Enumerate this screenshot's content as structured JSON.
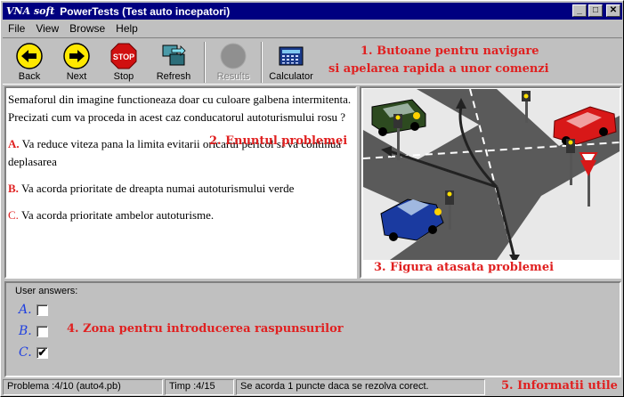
{
  "window": {
    "app_badge": "VNA soft",
    "title": "PowerTests (Test auto incepatori)",
    "buttons": {
      "minimize": "_",
      "maximize": "□",
      "close": "✕"
    }
  },
  "menu": {
    "items": [
      {
        "label": "File"
      },
      {
        "label": "View"
      },
      {
        "label": "Browse"
      },
      {
        "label": "Help"
      }
    ]
  },
  "toolbar": {
    "back": {
      "label": "Back",
      "icon": "arrow-left-icon"
    },
    "next": {
      "label": "Next",
      "icon": "arrow-right-icon"
    },
    "stop": {
      "label": "Stop",
      "icon": "stop-sign-icon",
      "sign_text": "STOP"
    },
    "refresh": {
      "label": "Refresh",
      "icon": "refresh-icon"
    },
    "results": {
      "label": "Results",
      "icon": "results-icon",
      "enabled": false
    },
    "calculator": {
      "label": "Calculator",
      "icon": "calculator-icon"
    }
  },
  "annotations": {
    "nav_line1": "1. Butoane pentru navigare",
    "nav_line2": "si apelarea rapida a unor comenzi",
    "problem": "2. Enuntul problemei",
    "figure": "3. Figura atasata problemei",
    "answers_zone": "4. Zona pentru introducerea raspunsurilor",
    "info": "5. Informatii utile"
  },
  "question": {
    "text": "Semaforul din imagine functioneaza doar cu culoare galbena intermitenta. Precizati cum va proceda in acest caz conducatorul autoturismului rosu ?",
    "answers": [
      {
        "letter": "A.",
        "text": "Va reduce viteza pana la limita evitarii oricarui pericol si va continua deplasarea"
      },
      {
        "letter": "B.",
        "text": "Va acorda prioritate de dreapta numai autoturismului verde"
      },
      {
        "letter": "C.",
        "text": "Va acorda prioritate ambelor autoturisme."
      }
    ]
  },
  "user_answers": {
    "label": "User answers:",
    "items": [
      {
        "letter": "A.",
        "checked": false
      },
      {
        "letter": "B.",
        "checked": false
      },
      {
        "letter": "C.",
        "checked": true,
        "mark": "✔"
      }
    ]
  },
  "status": {
    "problem": "Problema :4/10   (auto4.pb)",
    "time": "Timp :4/15",
    "info": "Se acorda 1 puncte daca se rezolva corect."
  },
  "colors": {
    "annotation_red": "#e02020",
    "answer_letter_blue": "#2040e0",
    "titlebar": "#000080"
  }
}
